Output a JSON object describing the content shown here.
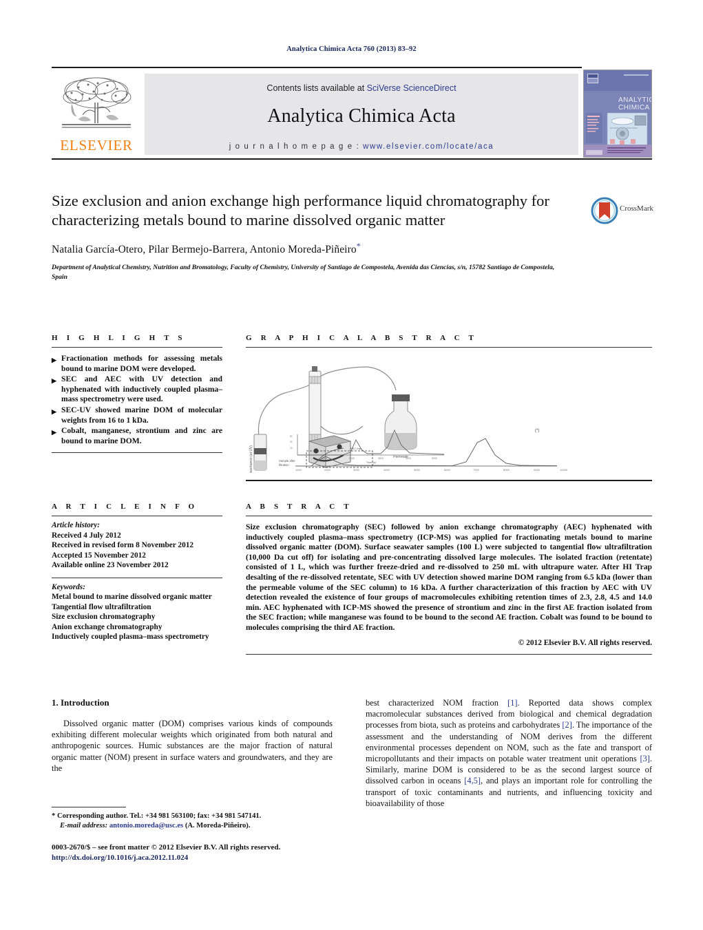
{
  "running_head": "Analytica Chimica Acta 760 (2013) 83–92",
  "masthead": {
    "contents_prefix": "Contents lists available at ",
    "contents_link": "SciVerse ScienceDirect",
    "journal_title": "Analytica Chimica Acta",
    "homepage_prefix": "j o u r n a l   h o m e p a g e :  ",
    "homepage_url": "www.elsevier.com/locate/aca",
    "publisher_logo_text": "ELSEVIER",
    "cover_title_line1": "ANALYTICA",
    "cover_title_line2": "CHIMICA ACTA"
  },
  "article": {
    "title": "Size exclusion and anion exchange high performance liquid chromatography for characterizing metals bound to marine dissolved organic matter",
    "authors": "Natalia García-Otero, Pilar Bermejo-Barrera, Antonio Moreda-Piñeiro",
    "corresponding_marker": "*",
    "affiliation": "Department of Analytical Chemistry, Nutrition and Bromatology, Faculty of Chemistry, University of Santiago de Compostela, Avenida das Ciencias, s/n, 15782 Santiago de Compostela, Spain",
    "crossmark_label": "CrossMark"
  },
  "highlights": {
    "heading": "H I G H L I G H T S",
    "items": [
      "Fractionation methods for assessing metals bound to marine DOM were developed.",
      "SEC and AEC with UV detection and hyphenated with inductively coupled plasma–mass spectrometry were used.",
      "SEC-UV showed marine DOM of molecular weights from 16 to 1 kDa.",
      "Cobalt, manganese, strontium and zinc are bound to marine DOM."
    ]
  },
  "graphical_abstract": {
    "heading": "G R A P H I C A L   A B S T R A C T",
    "caption_axis_y": "Absorbance (at UV)",
    "caption_axis_x": "Time (s)",
    "label_permeate": "Permeate",
    "label_sample": "Sample after filtration",
    "label_marker": "(*)"
  },
  "article_info": {
    "heading": "A R T I C L E    I N F O",
    "history_label": "Article history:",
    "history": [
      "Received 4 July 2012",
      "Received in revised form 8 November 2012",
      "Accepted 15 November 2012",
      "Available online 23 November 2012"
    ],
    "keywords_label": "Keywords:",
    "keywords": [
      "Metal bound to marine dissolved organic matter",
      "Tangential flow ultrafiltration",
      "Size exclusion chromatography",
      "Anion exchange chromatography",
      "Inductively coupled plasma–mass spectrometry"
    ]
  },
  "abstract": {
    "heading": "A B S T R A C T",
    "text": "Size exclusion chromatography (SEC) followed by anion exchange chromatography (AEC) hyphenated with inductively coupled plasma–mass spectrometry (ICP-MS) was applied for fractionating metals bound to marine dissolved organic matter (DOM). Surface seawater samples (100 L) were subjected to tangential flow ultrafiltration (10,000 Da cut off) for isolating and pre-concentrating dissolved large molecules. The isolated fraction (retentate) consisted of 1 L, which was further freeze-dried and re-dissolved to 250 mL with ultrapure water. After HI Trap desalting of the re-dissolved retentate, SEC with UV detection showed marine DOM ranging from 6.5 kDa (lower than the permeable volume of the SEC column) to 16 kDa. A further characterization of this fraction by AEC with UV detection revealed the existence of four groups of macromolecules exhibiting retention times of 2.3, 2.8, 4.5 and 14.0 min. AEC hyphenated with ICP-MS showed the presence of strontium and zinc in the first AE fraction isolated from the SEC fraction; while manganese was found to be bound to the second AE fraction. Cobalt was found to be bound to molecules comprising the third AE fraction.",
    "copyright": "© 2012 Elsevier B.V. All rights reserved."
  },
  "introduction": {
    "number_and_title": "1.  Introduction",
    "paragraph_left": "Dissolved organic matter (DOM) comprises various kinds of compounds exhibiting different molecular weights which originated from both natural and anthropogenic sources. Humic substances are the major fraction of natural organic matter (NOM) present in surface waters and groundwaters, and they are the",
    "paragraph_right_part1": "best characterized NOM fraction ",
    "ref1": "[1]",
    "paragraph_right_part2": ". Reported data shows complex macromolecular substances derived from biological and chemical degradation processes from biota, such as proteins and carbohydrates ",
    "ref2": "[2]",
    "paragraph_right_part3": ". The importance of the assessment and the understanding of NOM derives from the different environmental processes dependent on NOM, such as the fate and transport of micropollutants and their impacts on potable water treatment unit operations ",
    "ref3": "[3]",
    "paragraph_right_part4": ". Similarly, marine DOM is considered to be as the second largest source of dissolved carbon in oceans ",
    "ref45": "[4,5]",
    "paragraph_right_part5": ", and plays an important role for controlling the transport of toxic contaminants and nutrients, and influencing toxicity and bioavailability of those"
  },
  "footnote": {
    "corresponding": "* Corresponding author. Tel.: +34 981 563100; fax: +34 981 547141.",
    "email_label": "E-mail address:",
    "email": "antonio.moreda@usc.es",
    "email_suffix": " (A. Moreda-Piñeiro)."
  },
  "frontmatter": {
    "issn_line": "0003-2670/$ – see front matter © 2012 Elsevier B.V. All rights reserved.",
    "doi": "http://dx.doi.org/10.1016/j.aca.2012.11.024"
  },
  "colors": {
    "link_blue": "#2b3a8f",
    "elsevier_orange": "#F07F13",
    "header_navy": "#17255c",
    "masthead_grey": "#e6e6e8"
  }
}
